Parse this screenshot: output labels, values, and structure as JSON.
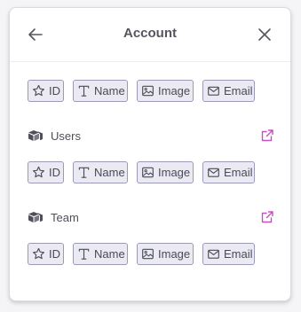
{
  "header": {
    "title": "Account"
  },
  "chips": {
    "id": "ID",
    "name": "Name",
    "image": "Image",
    "email": "Email"
  },
  "sections": [
    {
      "label": "Users"
    },
    {
      "label": "Team"
    }
  ],
  "colors": {
    "accent": "#c74fbf",
    "chip_border": "#9b9ab7",
    "chip_bg": "#ebeaf3"
  },
  "icons": {
    "back": "arrow-left-icon",
    "close": "close-icon",
    "id": "star-icon",
    "name": "text-icon",
    "image": "image-icon",
    "email": "mail-icon",
    "section": "cubes-icon",
    "external": "external-link-icon"
  }
}
